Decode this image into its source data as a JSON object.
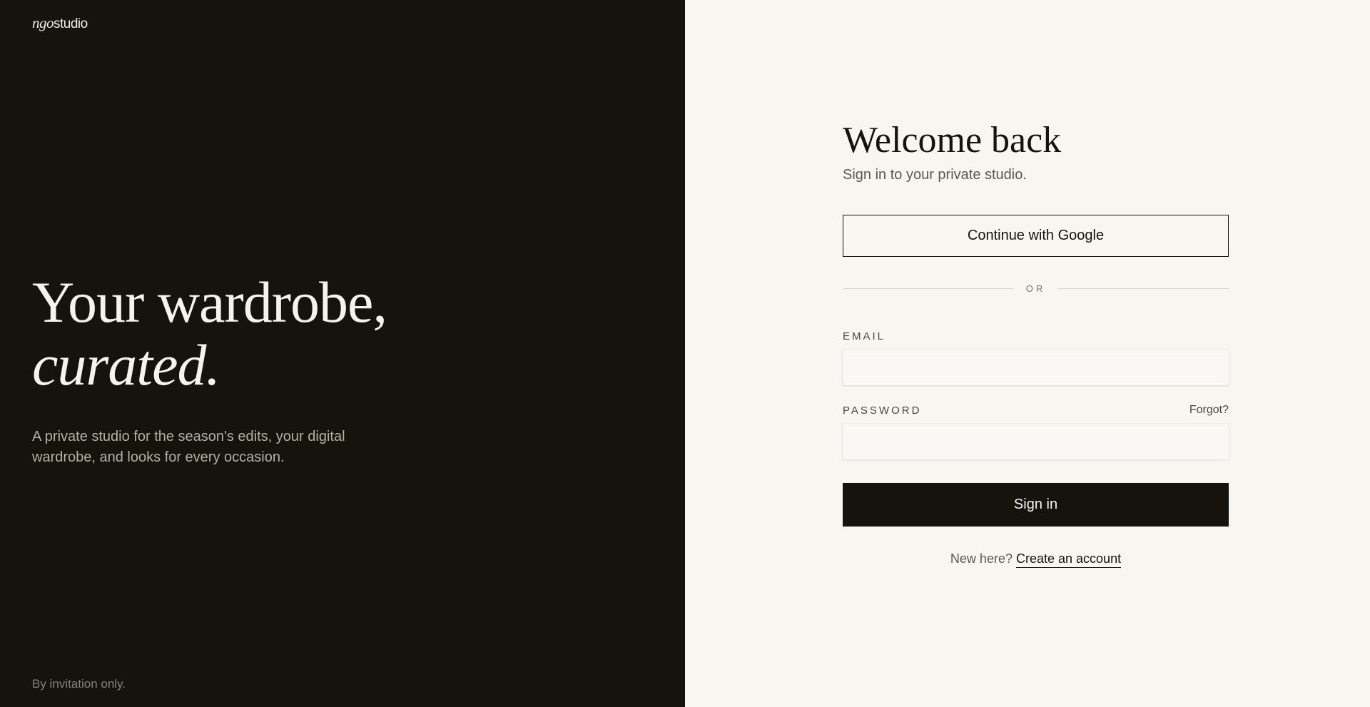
{
  "brand": {
    "logo_part1": "ngo",
    "logo_part2": "studio"
  },
  "hero": {
    "line1": "Your wardrobe,",
    "line2": "curated.",
    "description": "A private studio for the season's edits, your digital wardrobe, and looks for every occasion.",
    "footnote": "By invitation only."
  },
  "form": {
    "title": "Welcome back",
    "subtitle": "Sign in to your private studio.",
    "google_button": "Continue with Google",
    "divider_text": "OR",
    "email_label": "EMAIL",
    "email_value": "",
    "password_label": "PASSWORD",
    "password_value": "",
    "forgot_link": "Forgot?",
    "signin_button": "Sign in",
    "signup_prompt": "New here?",
    "signup_link": "Create an account"
  },
  "colors": {
    "dark_panel": "#16130d",
    "light_panel": "#f8f6f1",
    "primary_text": "#16130d"
  }
}
